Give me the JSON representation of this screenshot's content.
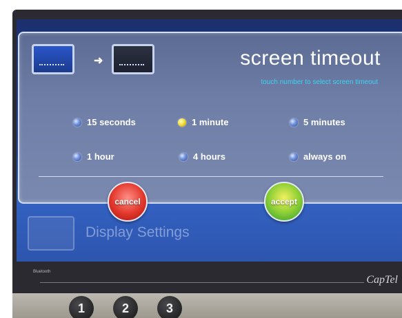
{
  "dialog": {
    "title": "screen timeout",
    "subtitle": "touch number to select screen timeout",
    "options": [
      {
        "label": "15 seconds",
        "selected": false
      },
      {
        "label": "1 minute",
        "selected": true
      },
      {
        "label": "5 minutes",
        "selected": false
      },
      {
        "label": "1 hour",
        "selected": false
      },
      {
        "label": "4 hours",
        "selected": false
      },
      {
        "label": "always on",
        "selected": false
      }
    ],
    "cancel_label": "cancel",
    "accept_label": "accept"
  },
  "background": {
    "screen_title": "Display Settings"
  },
  "device": {
    "brand": "CapTel",
    "bluetooth_label": "Bluetooth",
    "keys": [
      "1",
      "2",
      "3"
    ]
  },
  "colors": {
    "accent_cyan": "#3fd2f2",
    "selected_radio": "#f5e13a",
    "cancel": "#e2372b",
    "accept": "#8fd036"
  }
}
